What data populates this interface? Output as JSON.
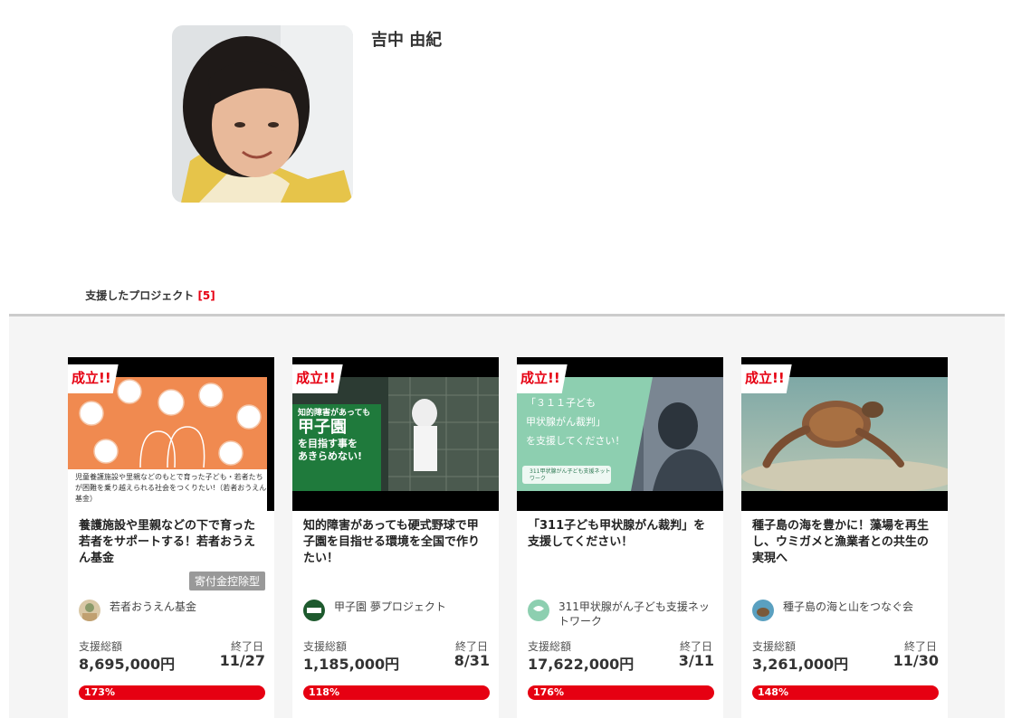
{
  "profile": {
    "name": "吉中 由紀"
  },
  "tabs": [
    {
      "label": "支援したプロジェクト",
      "count": "[5]"
    }
  ],
  "labels": {
    "achieved_badge": "成立!!",
    "total_label": "支援総額",
    "end_label": "終了日"
  },
  "projects": [
    {
      "title": "養護施設や里親などの下で育った若者をサポートする！若者おうえん基金",
      "tag": "寄付金控除型",
      "owner": "若者おうえん基金",
      "amount": "8,695,000円",
      "end_date": "11/27",
      "progress": "173%",
      "thumb_caption": "児童養護施設や里親などのもとで育った子ども・若者たちが困難を乗り越えられる社会をつくりたい!（若者おうえん基金）"
    },
    {
      "title": "知的障害があっても硬式野球で甲子園を目指せる環境を全国で作りたい！",
      "tag": "",
      "owner": "甲子園 夢プロジェクト",
      "amount": "1,185,000円",
      "end_date": "8/31",
      "progress": "118%",
      "thumb_lines": [
        "知的障害があっても",
        "甲子園",
        "を目指す事を",
        "あきらめない!"
      ]
    },
    {
      "title": "「311子ども甲状腺がん裁判」を支援してください！",
      "tag": "",
      "owner": "311甲状腺がん子ども支援ネットワーク",
      "amount": "17,622,000円",
      "end_date": "3/11",
      "progress": "176%",
      "thumb_lines": [
        "「３１１子ども",
        "甲状腺がん裁判」",
        "を支援してください！"
      ],
      "thumb_logo": "311甲状腺がん子ども支援ネットワーク"
    },
    {
      "title": "種子島の海を豊かに！藻場を再生し、ウミガメと漁業者との共生の実現へ",
      "tag": "",
      "owner": "種子島の海と山をつなぐ会",
      "amount": "3,261,000円",
      "end_date": "11/30",
      "progress": "148%"
    }
  ],
  "colors": {
    "accent": "#e60012",
    "tag_bg": "#999999",
    "grid_bg": "#f5f5f5"
  }
}
